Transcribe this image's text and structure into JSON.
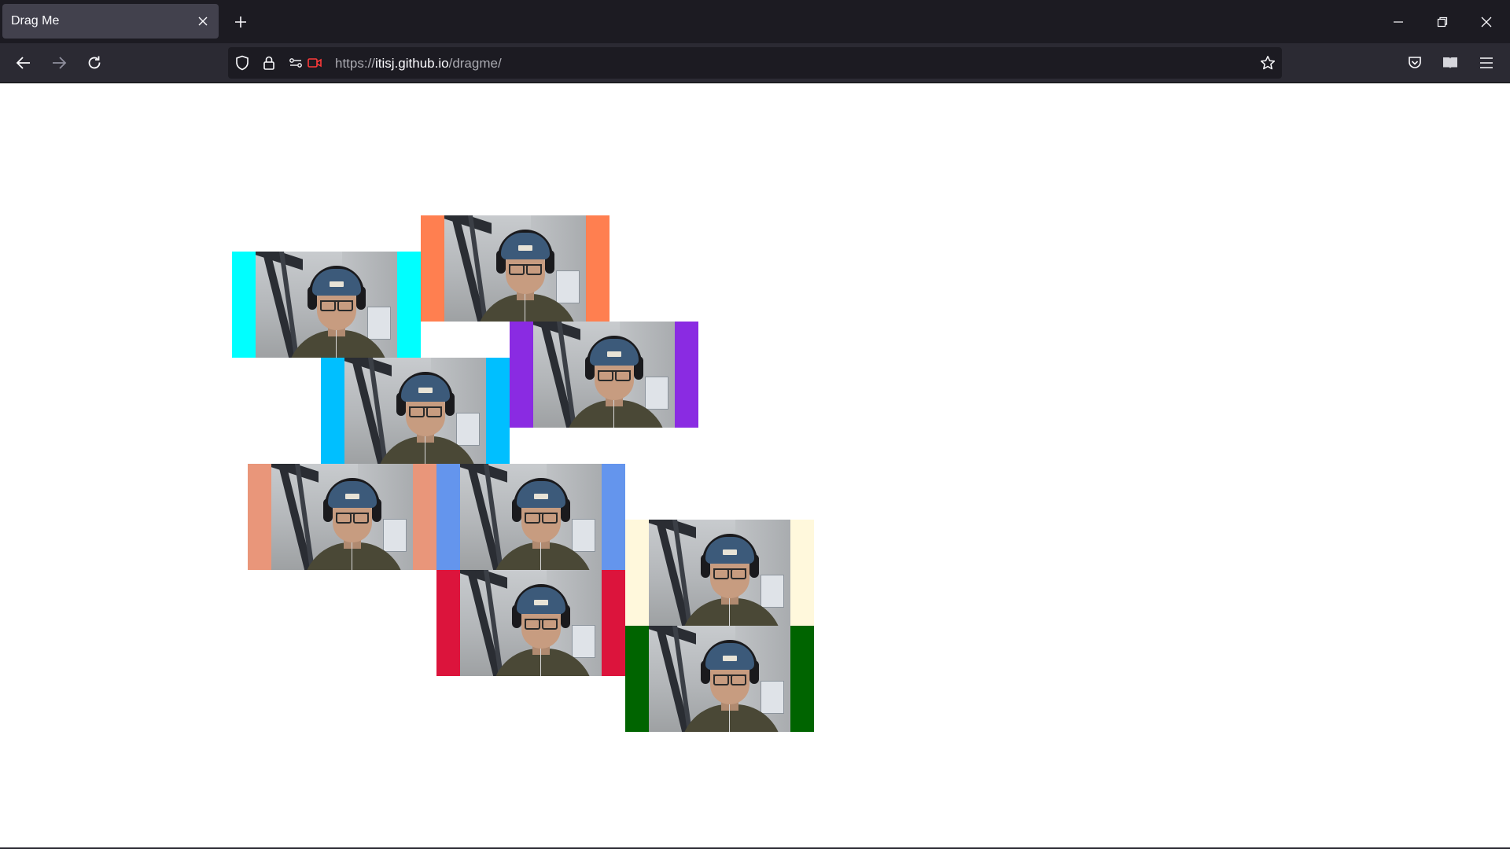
{
  "browser": {
    "tab_title": "Drag Me",
    "url_scheme": "https://",
    "url_host": "itisj.github.io",
    "url_path": "/dragme/"
  },
  "cards": [
    {
      "name": "card-cyan",
      "color": "#00ffff"
    },
    {
      "name": "card-coral",
      "color": "#ff7f50"
    },
    {
      "name": "card-blueviolet",
      "color": "#8a2be2"
    },
    {
      "name": "card-deepskyblue",
      "color": "#00bfff"
    },
    {
      "name": "card-darksalmon",
      "color": "#e9967a"
    },
    {
      "name": "card-cornflowerblue",
      "color": "#6495ed"
    },
    {
      "name": "card-cornsilk",
      "color": "#fff8dc"
    },
    {
      "name": "card-crimson",
      "color": "#dc143c"
    },
    {
      "name": "card-darkgreen",
      "color": "#006400"
    }
  ],
  "icons": {
    "tab_close": "close-icon",
    "new_tab": "plus-icon",
    "minimize": "minimize-icon",
    "restore": "restore-icon",
    "close_window": "close-icon",
    "back": "arrow-left-icon",
    "forward": "arrow-right-icon",
    "reload": "reload-icon",
    "tracking": "shield-icon",
    "lock": "lock-icon",
    "permissions": "permissions-icon",
    "camera": "camera-icon",
    "bookmark": "star-icon",
    "pocket": "pocket-icon",
    "reader": "reader-icon",
    "menu": "hamburger-icon"
  }
}
